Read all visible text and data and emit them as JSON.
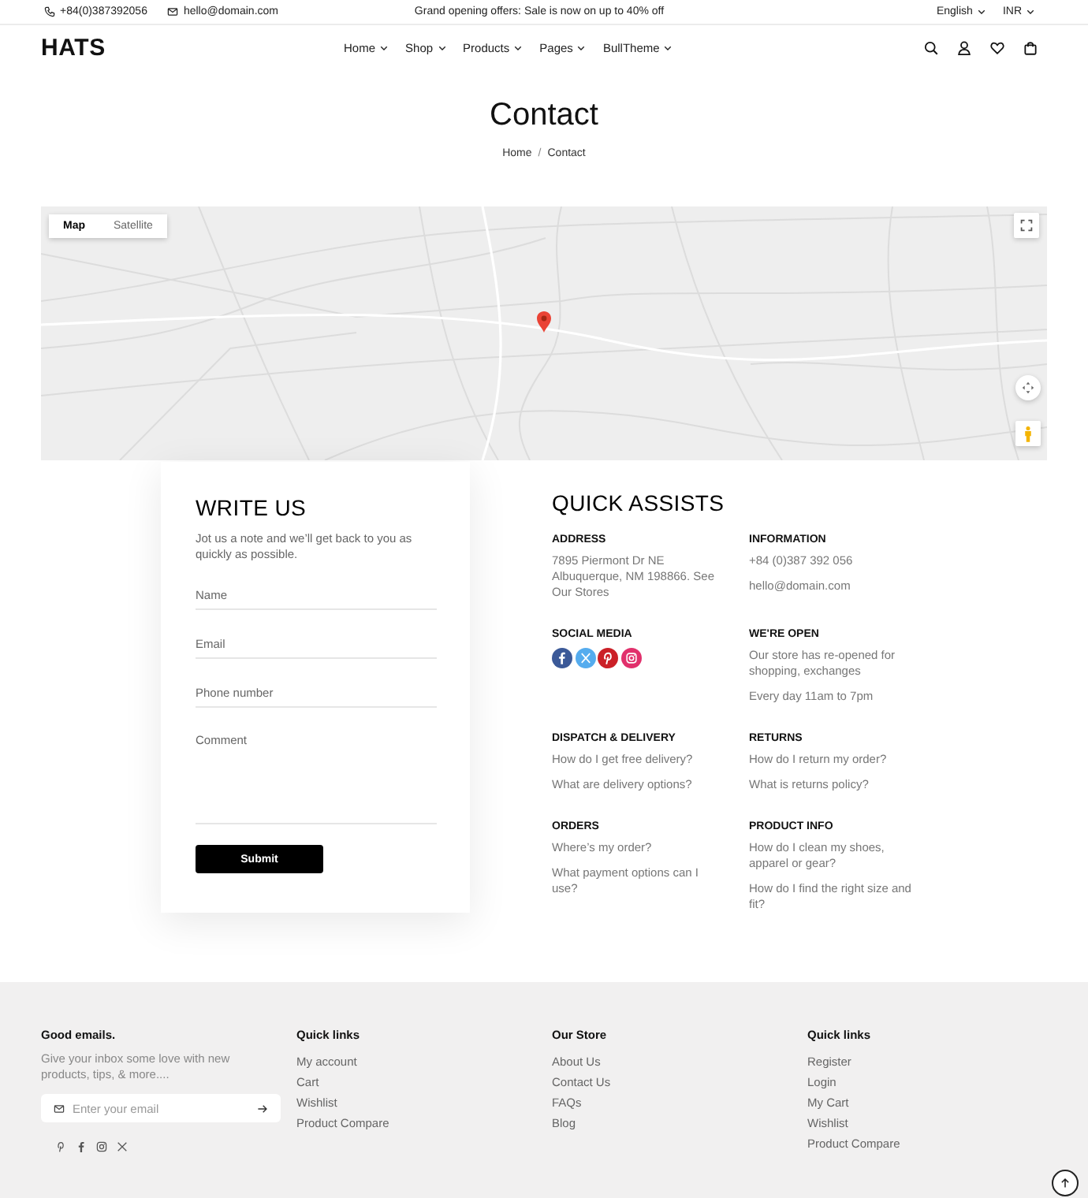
{
  "top_bar": {
    "phone": "+84(0)387392056",
    "email": "hello@domain.com",
    "announcement": "Grand opening offers: Sale is now on up to 40% off",
    "language": "English",
    "currency": "INR"
  },
  "header": {
    "logo": "HATS",
    "nav": [
      "Home",
      "Shop",
      "Products",
      "Pages",
      "BullTheme"
    ]
  },
  "page_header": {
    "title": "Contact",
    "breadcrumb": [
      "Home",
      "Contact"
    ],
    "separator": "/"
  },
  "map": {
    "tabs": [
      {
        "label": "Map",
        "selected": true
      },
      {
        "label": "Satellite",
        "selected": false
      }
    ]
  },
  "write_us": {
    "title": "WRITE US",
    "description": "Jot us a note and we’ll get back to you as quickly as possible.",
    "fields": [
      {
        "kind": "input",
        "placeholder": "Name"
      },
      {
        "kind": "input",
        "placeholder": "Email"
      },
      {
        "kind": "input",
        "placeholder": "Phone number"
      },
      {
        "kind": "textarea",
        "placeholder": "Comment"
      }
    ],
    "submit": "Submit"
  },
  "quick_assists": {
    "title": "QUICK ASSISTS",
    "sections": [
      {
        "kind": "text",
        "heading": "ADDRESS",
        "lines": [
          "7895 Piermont Dr NE Albuquerque, NM 198866. See Our Stores"
        ]
      },
      {
        "kind": "text",
        "heading": "INFORMATION",
        "lines": [
          "+84 (0)387 392 056",
          "hello@domain.com"
        ]
      },
      {
        "kind": "social",
        "heading": "SOCIAL MEDIA"
      },
      {
        "kind": "text",
        "heading": "WE'RE OPEN",
        "lines": [
          "Our store has re-opened for shopping, exchanges",
          "Every day 11am to 7pm"
        ]
      },
      {
        "kind": "links",
        "heading": "DISPATCH & DELIVERY",
        "lines": [
          "How do I get free delivery?",
          "What are delivery options?"
        ]
      },
      {
        "kind": "links",
        "heading": "RETURNS",
        "lines": [
          "How do I return my order?",
          "What is returns policy?"
        ]
      },
      {
        "kind": "links",
        "heading": "ORDERS",
        "lines": [
          "Where’s my order?",
          "What payment options can I use?"
        ]
      },
      {
        "kind": "links",
        "heading": "PRODUCT INFO",
        "lines": [
          "How do I clean my shoes, apparel or gear?",
          "How do I find the right size and fit?"
        ]
      }
    ]
  },
  "footer": {
    "newsletter": {
      "heading": "Good emails.",
      "description": "Give your inbox some love with new products, tips, & more....",
      "placeholder": "Enter your email"
    },
    "columns": [
      {
        "heading": "Quick links",
        "links": [
          "My account",
          "Cart",
          "Wishlist",
          "Product Compare"
        ]
      },
      {
        "heading": "Our Store",
        "links": [
          "About Us",
          "Contact Us",
          "FAQs",
          "Blog"
        ]
      },
      {
        "heading": "Quick links",
        "links": [
          "Register",
          "Login",
          "My Cart",
          "Wishlist",
          "Product Compare"
        ]
      }
    ]
  }
}
